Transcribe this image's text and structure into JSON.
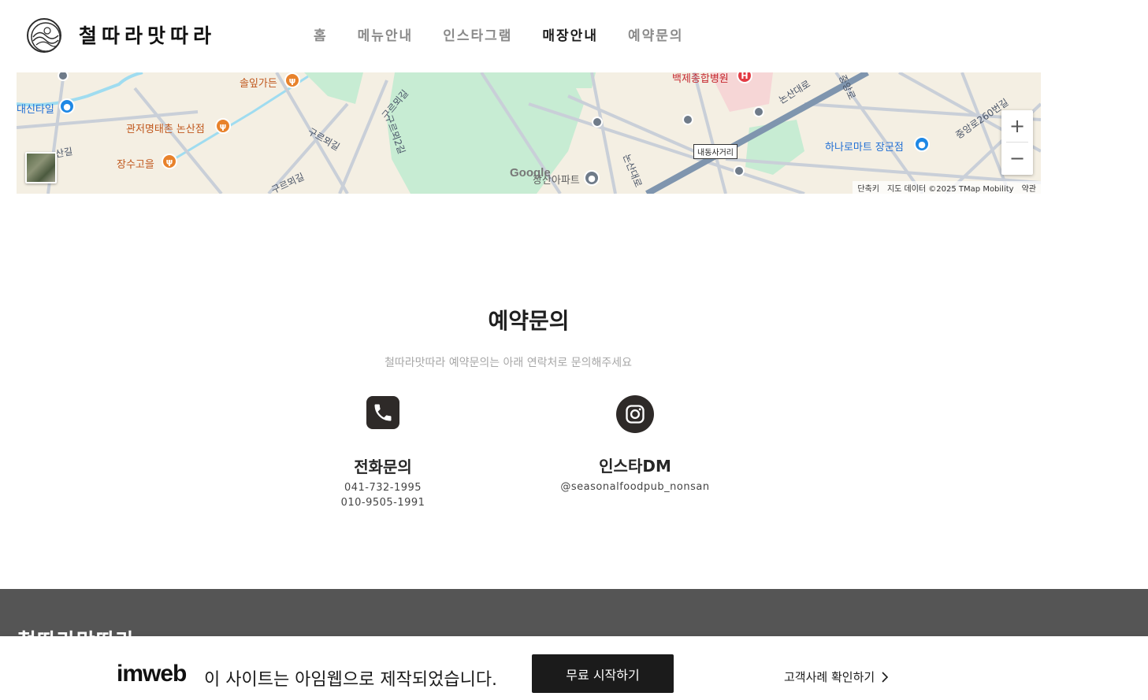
{
  "site": {
    "logo_icon": "circle-emblem-icon",
    "name": "철따라맛따라"
  },
  "nav": {
    "items": [
      {
        "label": "홈",
        "active": false
      },
      {
        "label": "메뉴안내",
        "active": false
      },
      {
        "label": "인스타그램",
        "active": false
      },
      {
        "label": "매장안내",
        "active": true
      },
      {
        "label": "예약문의",
        "active": false
      }
    ]
  },
  "map": {
    "labels": {
      "daeshin": "대신타일",
      "sol_garden": "솔잎가든",
      "gwanjeo": "관저명태촌 논산점",
      "jangsu": "장수고을",
      "baekje": "백제종합병원",
      "gusiroegil": "구르뫼길",
      "gusiroegil2": "구르뫼2길",
      "gusiroegil3": "구르뫼길",
      "gusiroegil4": "구르뫼길",
      "sangil": "산길",
      "jangsan_apt": "장산아파트",
      "nonsandaero": "논산대로",
      "nonsandaero2": "논산대로",
      "hanaro": "하나로마트 장군점",
      "jungang260": "중앙로260번길",
      "sign": "내동사거리",
      "jungangro": "중앙로"
    },
    "zoom_in": "+",
    "zoom_out": "−",
    "google": "Google",
    "attribution": {
      "shortcuts": "단축키",
      "map_data": "지도 데이터 ©2025 TMap Mobility",
      "terms": "약관"
    }
  },
  "reservation": {
    "title": "예약문의",
    "subtitle": "철따라맛따라 예약문의는 아래 연락처로 문의해주세요",
    "phone": {
      "icon": "phone-icon",
      "title": "전화문의",
      "numbers": [
        "041-732-1995",
        "010-9505-1991"
      ]
    },
    "instagram": {
      "icon": "instagram-icon",
      "title": "인스타DM",
      "handle": "@seasonalfoodpub_nonsan"
    }
  },
  "footer": {
    "name": "철따라맛따라"
  },
  "imweb": {
    "logo": "imweb",
    "message": "이 사이트는 아임웹으로 제작되었습니다.",
    "cta": "무료 시작하기",
    "link": "고객사례 확인하기"
  }
}
